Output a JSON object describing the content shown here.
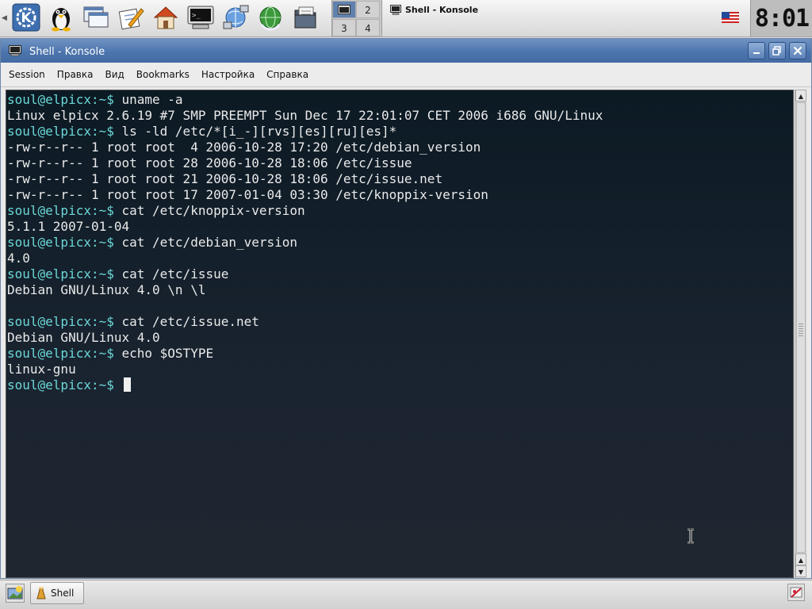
{
  "taskbar_top": {
    "pager": {
      "desktops": [
        "",
        "2",
        "3",
        "4"
      ]
    },
    "active_task": "Shell - Konsole",
    "clock": "8:01"
  },
  "launchers": [
    {
      "name": "kde-menu-icon"
    },
    {
      "name": "tux-icon"
    },
    {
      "name": "window-list-icon"
    },
    {
      "name": "editor-icon"
    },
    {
      "name": "home-icon"
    },
    {
      "name": "terminal-icon"
    },
    {
      "name": "network-icon"
    },
    {
      "name": "browser-icon"
    },
    {
      "name": "file-manager-icon"
    }
  ],
  "window": {
    "title": "Shell - Konsole",
    "menu": [
      "Session",
      "Правка",
      "Вид",
      "Bookmarks",
      "Настройка",
      "Справка"
    ]
  },
  "terminal": {
    "lines": [
      {
        "prompt": "soul@elpicx:~$",
        "text": " uname -a"
      },
      {
        "prompt": "",
        "text": "Linux elpicx 2.6.19 #7 SMP PREEMPT Sun Dec 17 22:01:07 CET 2006 i686 GNU/Linux"
      },
      {
        "prompt": "soul@elpicx:~$",
        "text": " ls -ld /etc/*[i_-][rvs][es][ru][es]*"
      },
      {
        "prompt": "",
        "text": "-rw-r--r-- 1 root root  4 2006-10-28 17:20 /etc/debian_version"
      },
      {
        "prompt": "",
        "text": "-rw-r--r-- 1 root root 28 2006-10-28 18:06 /etc/issue"
      },
      {
        "prompt": "",
        "text": "-rw-r--r-- 1 root root 21 2006-10-28 18:06 /etc/issue.net"
      },
      {
        "prompt": "",
        "text": "-rw-r--r-- 1 root root 17 2007-01-04 03:30 /etc/knoppix-version"
      },
      {
        "prompt": "soul@elpicx:~$",
        "text": " cat /etc/knoppix-version"
      },
      {
        "prompt": "",
        "text": "5.1.1 2007-01-04"
      },
      {
        "prompt": "soul@elpicx:~$",
        "text": " cat /etc/debian_version"
      },
      {
        "prompt": "",
        "text": "4.0"
      },
      {
        "prompt": "soul@elpicx:~$",
        "text": " cat /etc/issue"
      },
      {
        "prompt": "",
        "text": "Debian GNU/Linux 4.0 \\n \\l"
      },
      {
        "prompt": "",
        "text": ""
      },
      {
        "prompt": "soul@elpicx:~$",
        "text": " cat /etc/issue.net"
      },
      {
        "prompt": "",
        "text": "Debian GNU/Linux 4.0"
      },
      {
        "prompt": "soul@elpicx:~$",
        "text": " echo $OSTYPE"
      },
      {
        "prompt": "",
        "text": "linux-gnu"
      },
      {
        "prompt": "soul@elpicx:~$",
        "text": " "
      }
    ]
  },
  "taskbar_bottom": {
    "task_label": "Shell"
  },
  "colors": {
    "prompt": "#6bd7d7",
    "output": "#eaeaea",
    "terminal_bg": "#1a2430",
    "titlebar": "#4d75ad"
  }
}
